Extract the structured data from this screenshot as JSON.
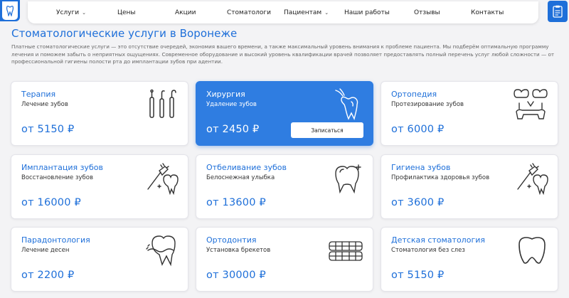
{
  "nav": {
    "items": [
      {
        "label": "Услуги",
        "dropdown": true
      },
      {
        "label": "Цены",
        "dropdown": false
      },
      {
        "label": "Акции",
        "dropdown": false
      },
      {
        "label": "Стоматологи",
        "dropdown": false
      },
      {
        "label": "Пациентам",
        "dropdown": true
      },
      {
        "label": "Наши работы",
        "dropdown": false
      },
      {
        "label": "Отзывы",
        "dropdown": false
      },
      {
        "label": "Контакты",
        "dropdown": false
      }
    ]
  },
  "page": {
    "title": "Стоматологические услуги в Воронеже",
    "description": "Платные стоматологические услуги — это отсутствие очередей, экономия вашего времени, а также максимальный уровень внимания к проблеме пациента. Мы подберём оптимальную программу лечения и поможем забыть о неприятных ощущениях. Современное оборудование и высокий уровень квалификации врачей позволяет предоставлять полный перечень услуг любой сложности — от профессиональной гигиены полости рта до имплантации зубов при адентии."
  },
  "colors": {
    "accent": "#1e6fd9",
    "active_card": "#2f7de1",
    "background": "#f3f3f5"
  },
  "services": [
    {
      "title": "Терапия",
      "subtitle": "Лечение зубов",
      "price": "от 5150 ₽",
      "icon": "dental-tools-icon"
    },
    {
      "title": "Хирургия",
      "subtitle": "Удаление зубов",
      "price": "от 2450 ₽",
      "icon": "tooth-extraction-icon",
      "active": true,
      "button": "Записаться"
    },
    {
      "title": "Ортопедия",
      "subtitle": "Протезирование зубов",
      "price": "от 6000 ₽",
      "icon": "dental-bridge-icon"
    },
    {
      "title": "Имплантация зубов",
      "subtitle": "Восстановление зубов",
      "price": "от 16000 ₽",
      "icon": "toothbrush-tooth-icon"
    },
    {
      "title": "Отбеливание зубов",
      "subtitle": "Белоснежная улыбка",
      "price": "от 13600 ₽",
      "icon": "shiny-tooth-icon"
    },
    {
      "title": "Гигиена зубов",
      "subtitle": "Профилактика здоровья зубов",
      "price": "от 3600 ₽",
      "icon": "toothbrush-tooth-icon"
    },
    {
      "title": "Парадонтология",
      "subtitle": "Лечение десен",
      "price": "от 2200 ₽",
      "icon": "gum-tooth-icon"
    },
    {
      "title": "Ортодонтия",
      "subtitle": "Установка брекетов",
      "price": "от 30000 ₽",
      "icon": "braces-icon"
    },
    {
      "title": "Детская стоматология",
      "subtitle": "Стоматология без слез",
      "price": "от 5150 ₽",
      "icon": "baby-tooth-icon"
    }
  ]
}
